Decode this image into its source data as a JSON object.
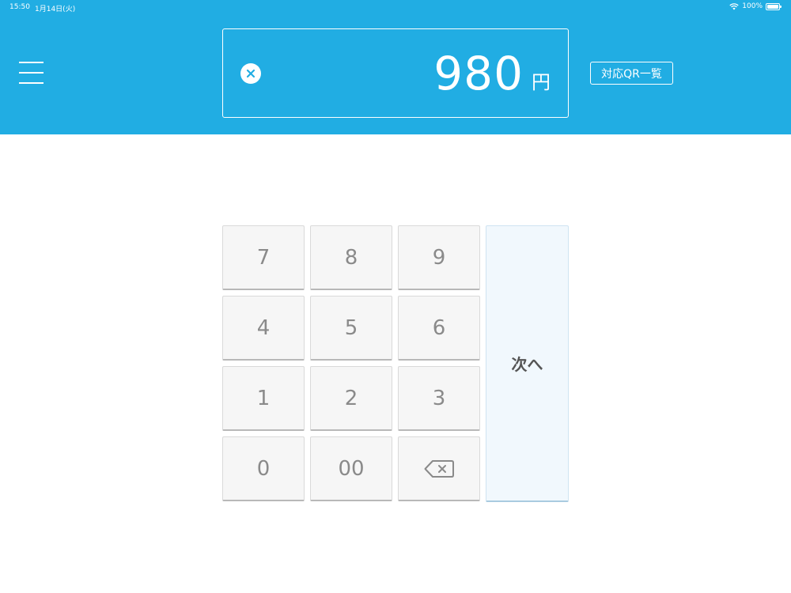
{
  "status_bar": {
    "time": "15:50",
    "date": "1月14日(火)",
    "battery": "100%",
    "wifi_icon": "wifi-icon",
    "battery_icon": "battery-icon"
  },
  "header": {
    "menu_icon": "hamburger-menu-icon",
    "amount": "980",
    "currency": "円",
    "clear_icon": "close-circle-icon",
    "qr_button_label": "対応QR一覧",
    "background_color": "#21ade3"
  },
  "keypad": {
    "keys": [
      "7",
      "8",
      "9",
      "4",
      "5",
      "6",
      "1",
      "2",
      "3",
      "0",
      "00"
    ],
    "backspace_icon": "backspace-icon",
    "next_label": "次へ"
  }
}
